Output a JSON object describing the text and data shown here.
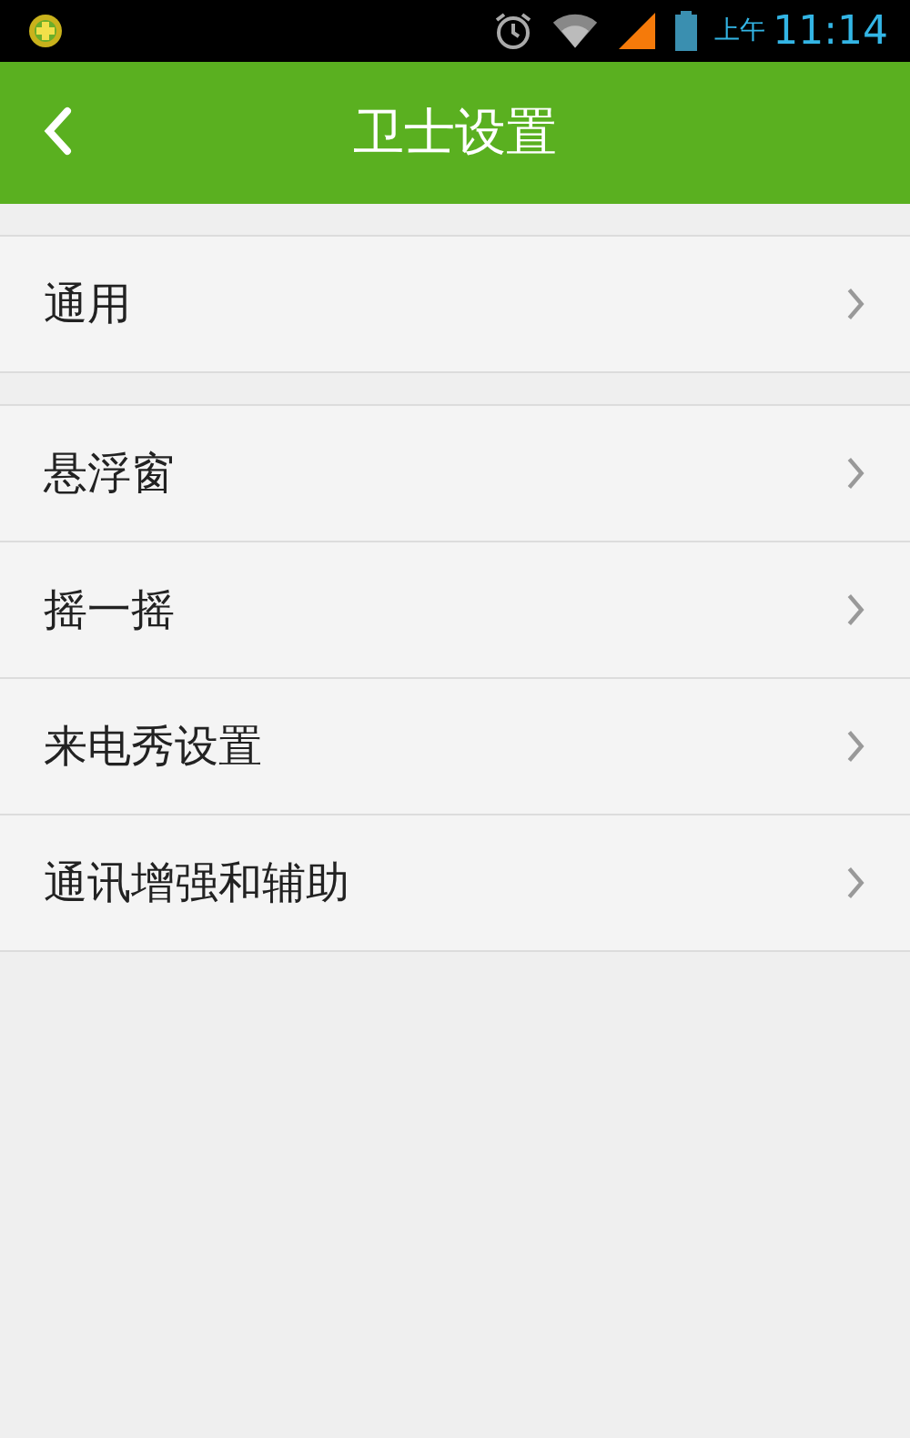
{
  "status_bar": {
    "period": "上午",
    "time": "11:14"
  },
  "header": {
    "title": "卫士设置"
  },
  "groups": [
    {
      "items": [
        {
          "label": "通用"
        }
      ]
    },
    {
      "items": [
        {
          "label": "悬浮窗"
        },
        {
          "label": "摇一摇"
        },
        {
          "label": "来电秀设置"
        },
        {
          "label": "通讯增强和辅助"
        }
      ]
    }
  ]
}
